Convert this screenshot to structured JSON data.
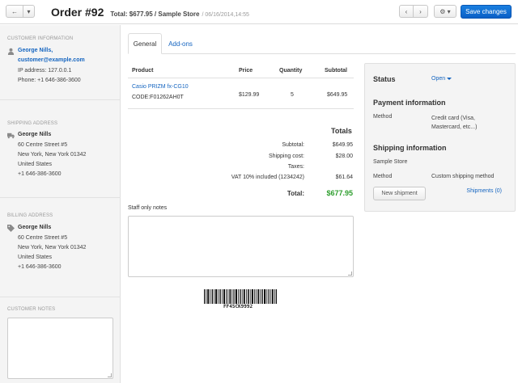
{
  "header": {
    "back_icon": "←",
    "dropdown_icon": "▾",
    "title": "Order #92",
    "total_store": "Total: $677.95 / Sample Store",
    "date": "/ 06/16/2014,14:55",
    "prev_icon": "‹",
    "next_icon": "›",
    "gear_icon": "⚙ ▾",
    "save_label": "Save changes"
  },
  "sidebar": {
    "customer": {
      "heading": "CUSTOMER INFORMATION",
      "name": "George Nills,",
      "email": "customer@example.com",
      "ip": "IP address: 127.0.0.1",
      "phone": "Phone: +1 646-386-3600"
    },
    "shipping": {
      "heading": "SHIPPING ADDRESS",
      "name": "George Nills",
      "street": "60 Centre Street #5",
      "city": "New York, New York 01342",
      "country": "United States",
      "phone": "+1 646-386-3600"
    },
    "billing": {
      "heading": "BILLING ADDRESS",
      "name": "George Nills",
      "street": "60 Centre Street #5",
      "city": "New York, New York 01342",
      "country": "United States",
      "phone": "+1 646-386-3600"
    },
    "notes_heading": "CUSTOMER NOTES"
  },
  "tabs": [
    {
      "label": "General"
    },
    {
      "label": "Add-ons"
    }
  ],
  "products": {
    "headers": {
      "product": "Product",
      "price": "Price",
      "quantity": "Quantity",
      "subtotal": "Subtotal"
    },
    "rows": [
      {
        "name": "Casio PRIZM fx-CG10",
        "code": "CODE:F01262AH0T",
        "price": "$129.99",
        "quantity": "5",
        "subtotal": "$649.95"
      }
    ]
  },
  "totals": {
    "title": "Totals",
    "subtotal_label": "Subtotal:",
    "subtotal": "$649.95",
    "shipping_label": "Shipping cost:",
    "shipping": "$28.00",
    "taxes_label": "Taxes:",
    "vat_label": "VAT 10% included (1234242)",
    "vat": "$61.64",
    "total_label": "Total:",
    "total": "$677.95"
  },
  "staff_notes_label": "Staff only notes",
  "barcode_text": "FF45CK9992",
  "right_panel": {
    "status_title": "Status",
    "status_value": "Open",
    "payment_title": "Payment information",
    "method_label": "Method",
    "payment_method": "Credit card (Visa, Mastercard, etc...)",
    "shipping_title": "Shipping information",
    "store": "Sample Store",
    "ship_method_label": "Method",
    "ship_method": "Custom shipping method",
    "new_shipment": "New shipment",
    "shipments_link": "Shipments (0)"
  },
  "colors": {
    "accent": "#1565c0",
    "save_button": "#0a68d4",
    "total_green": "#2e9e2e"
  }
}
